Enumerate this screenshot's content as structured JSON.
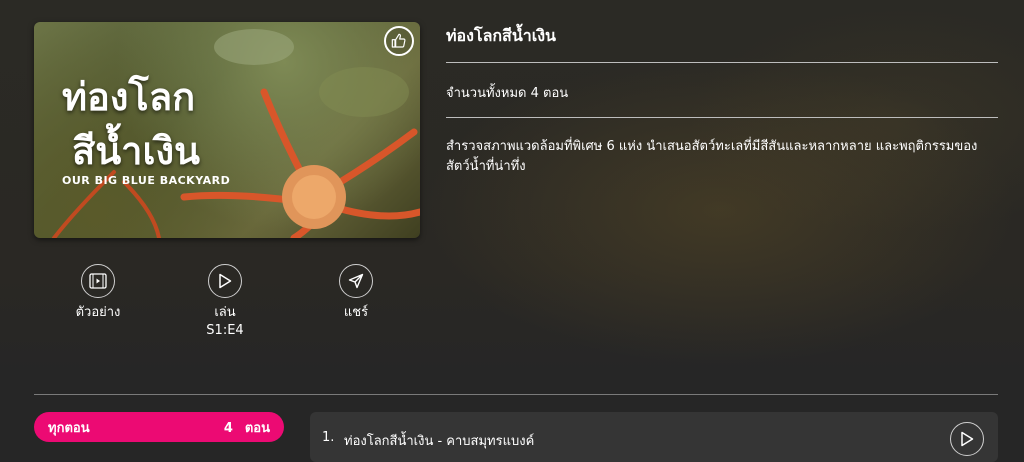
{
  "poster": {
    "title_line1": "ท่องโลก",
    "title_line2": "สีน้ำเงิน",
    "subtitle": "OUR BIG BLUE BACKYARD",
    "like_icon": "thumbs-up-icon"
  },
  "actions": {
    "trailer": {
      "label": "ตัวอย่าง",
      "icon": "film-icon"
    },
    "play": {
      "label": "เล่น",
      "episode": "S1:E4",
      "icon": "play-icon"
    },
    "share": {
      "label": "แชร์",
      "icon": "send-icon"
    }
  },
  "details": {
    "title": "ท่องโลกสีน้ำเงิน",
    "episode_count": "จำนวนทั้งหมด 4 ตอน",
    "description": "สำรวจสภาพแวดล้อมที่พิเศษ 6 แห่ง นำเสนอสัตว์ทะเลที่มีสีสันและหลากหลาย และพฤติกรรมของสัตว์น้ำที่น่าทึ่ง"
  },
  "episodes_tab": {
    "label": "ทุกตอน",
    "count": "4",
    "unit": "ตอน"
  },
  "episodes": [
    {
      "number": "1.",
      "title": "ท่องโลกสีน้ำเงิน - คาบสมุทรแบงค์"
    }
  ],
  "colors": {
    "accent": "#ec0a73",
    "background": "#262626"
  }
}
